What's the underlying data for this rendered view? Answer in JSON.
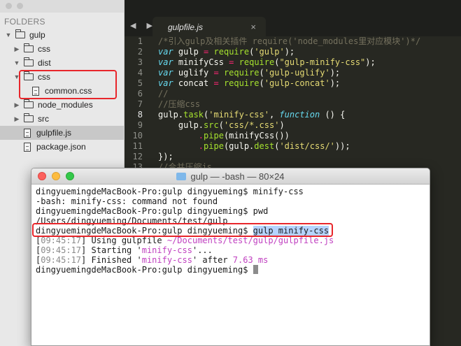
{
  "sidebar": {
    "heading": "FOLDERS",
    "items": [
      {
        "label": "gulp",
        "kind": "folder",
        "expanded": true,
        "depth": 0
      },
      {
        "label": "css",
        "kind": "folder",
        "expanded": false,
        "depth": 1
      },
      {
        "label": "dist",
        "kind": "folder",
        "expanded": true,
        "depth": 1
      },
      {
        "label": "css",
        "kind": "folder",
        "expanded": true,
        "depth": 2
      },
      {
        "label": "common.css",
        "kind": "file",
        "depth": 3
      },
      {
        "label": "node_modules",
        "kind": "folder",
        "expanded": false,
        "depth": 1
      },
      {
        "label": "src",
        "kind": "folder",
        "expanded": false,
        "depth": 1
      },
      {
        "label": "gulpfile.js",
        "kind": "file",
        "depth": 1,
        "selected": true
      },
      {
        "label": "package.json",
        "kind": "file",
        "depth": 1
      }
    ]
  },
  "editor": {
    "nav": "◀ ▶",
    "tab": {
      "name": "gulpfile.js",
      "close": "×"
    },
    "lines": [
      {
        "n": "1",
        "t": [
          [
            "cm",
            "/*引入gulp及相关插件 require('node_modules里对应模块')*/"
          ]
        ]
      },
      {
        "n": "2",
        "t": [
          [
            "kw",
            "var"
          ],
          [
            "",
            " gulp "
          ],
          [
            "op",
            "="
          ],
          [
            "",
            " "
          ],
          [
            "fn",
            "require"
          ],
          [
            "",
            "("
          ],
          [
            "st",
            "'gulp'"
          ],
          [
            "",
            ");"
          ]
        ]
      },
      {
        "n": "3",
        "t": [
          [
            "kw",
            "var"
          ],
          [
            "",
            " minifyCss "
          ],
          [
            "op",
            "="
          ],
          [
            "",
            " "
          ],
          [
            "fn",
            "require"
          ],
          [
            "",
            "("
          ],
          [
            "st",
            "\"gulp-minify-css\""
          ],
          [
            "",
            ");"
          ]
        ]
      },
      {
        "n": "4",
        "t": [
          [
            "kw",
            "var"
          ],
          [
            "",
            " uglify "
          ],
          [
            "op",
            "="
          ],
          [
            "",
            " "
          ],
          [
            "fn",
            "require"
          ],
          [
            "",
            "("
          ],
          [
            "st",
            "'gulp-uglify'"
          ],
          [
            "",
            ");"
          ]
        ]
      },
      {
        "n": "5",
        "t": [
          [
            "kw",
            "var"
          ],
          [
            "",
            " concat "
          ],
          [
            "op",
            "="
          ],
          [
            "",
            " "
          ],
          [
            "fn",
            "require"
          ],
          [
            "",
            "("
          ],
          [
            "st",
            "'gulp-concat'"
          ],
          [
            "",
            ");"
          ]
        ]
      },
      {
        "n": "6",
        "t": [
          [
            "cm",
            "//"
          ]
        ]
      },
      {
        "n": "7",
        "t": [
          [
            "cm",
            "//压缩css"
          ]
        ]
      },
      {
        "n": "8",
        "t": [
          [
            "",
            "gulp."
          ],
          [
            "fn",
            "task"
          ],
          [
            "",
            "("
          ],
          [
            "st",
            "'minify-css'"
          ],
          [
            "",
            ", "
          ],
          [
            "kw",
            "function"
          ],
          [
            "",
            " () {"
          ]
        ],
        "hl": true
      },
      {
        "n": "9",
        "t": [
          [
            "",
            "    gulp."
          ],
          [
            "fn",
            "src"
          ],
          [
            "",
            "("
          ],
          [
            "st",
            "'css/*.css'"
          ],
          [
            "",
            ")"
          ]
        ]
      },
      {
        "n": "10",
        "t": [
          [
            "op",
            "        ."
          ],
          [
            "fn",
            "pipe"
          ],
          [
            "",
            "(minifyCss())"
          ]
        ]
      },
      {
        "n": "11",
        "t": [
          [
            "op",
            "        ."
          ],
          [
            "fn",
            "pipe"
          ],
          [
            "",
            "(gulp."
          ],
          [
            "fn",
            "dest"
          ],
          [
            "",
            "("
          ],
          [
            "st",
            "'dist/css/'"
          ],
          [
            "",
            "));"
          ]
        ]
      },
      {
        "n": "12",
        "t": [
          [
            "",
            "});"
          ]
        ]
      },
      {
        "n": "13",
        "t": [
          [
            "cm",
            "//合并压缩js"
          ]
        ]
      }
    ]
  },
  "terminal": {
    "title": "gulp — -bash — 80×24",
    "lines": [
      [
        [
          "",
          "dingyuemingdeMacBook-Pro:gulp dingyueming$ minify-css"
        ]
      ],
      [
        [
          "",
          "-bash: minify-css: command not found"
        ]
      ],
      [
        [
          "",
          "dingyuemingdeMacBook-Pro:gulp dingyueming$ pwd"
        ]
      ],
      [
        [
          "",
          "/Users/dingyueming/Documents/test/gulp"
        ]
      ],
      [
        [
          "",
          "dingyuemingdeMacBook-Pro:gulp dingyueming$ "
        ],
        [
          "sel",
          "gulp minify-css"
        ]
      ],
      [
        [
          "",
          "["
        ],
        [
          "grey",
          "09:45:17"
        ],
        [
          "",
          "] Using gulpfile "
        ],
        [
          "path",
          "~/Documents/test/gulp/gulpfile.js"
        ]
      ],
      [
        [
          "",
          "["
        ],
        [
          "grey",
          "09:45:17"
        ],
        [
          "",
          "] Starting '"
        ],
        [
          "mag",
          "minify-css"
        ],
        [
          "",
          "'..."
        ]
      ],
      [
        [
          "",
          "["
        ],
        [
          "grey",
          "09:45:17"
        ],
        [
          "",
          "] Finished '"
        ],
        [
          "mag",
          "minify-css"
        ],
        [
          "",
          "' after "
        ],
        [
          "mag",
          "7.63 ms"
        ]
      ],
      [
        [
          "",
          "dingyuemingdeMacBook-Pro:gulp dingyueming$ "
        ],
        [
          "cursor",
          ""
        ]
      ]
    ]
  },
  "colors": {
    "annotation": "#e8262b",
    "editor_bg": "#272822",
    "selection": "#b5d3ff"
  }
}
